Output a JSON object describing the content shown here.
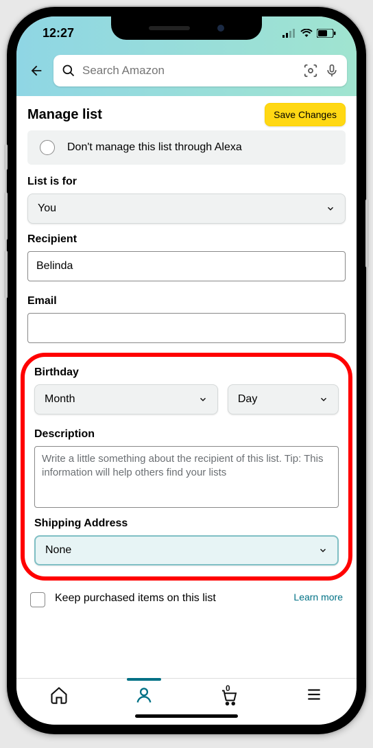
{
  "status": {
    "time": "12:27"
  },
  "search": {
    "placeholder": "Search Amazon"
  },
  "page": {
    "title": "Manage list",
    "save_label": "Save Changes"
  },
  "alexa": {
    "label": "Don't manage this list through Alexa"
  },
  "list_for": {
    "label": "List is for",
    "value": "You"
  },
  "recipient": {
    "label": "Recipient",
    "value": "Belinda"
  },
  "email": {
    "label": "Email",
    "value": ""
  },
  "birthday": {
    "label": "Birthday",
    "month": "Month",
    "day": "Day"
  },
  "description": {
    "label": "Description",
    "placeholder": "Write a little something about the recipient of this list. Tip: This information will help others find your lists"
  },
  "shipping": {
    "label": "Shipping Address",
    "value": "None"
  },
  "keep": {
    "label": "Keep purchased items on this list",
    "learn_more": "Learn more"
  },
  "tabbar": {
    "cart_count": "0"
  }
}
